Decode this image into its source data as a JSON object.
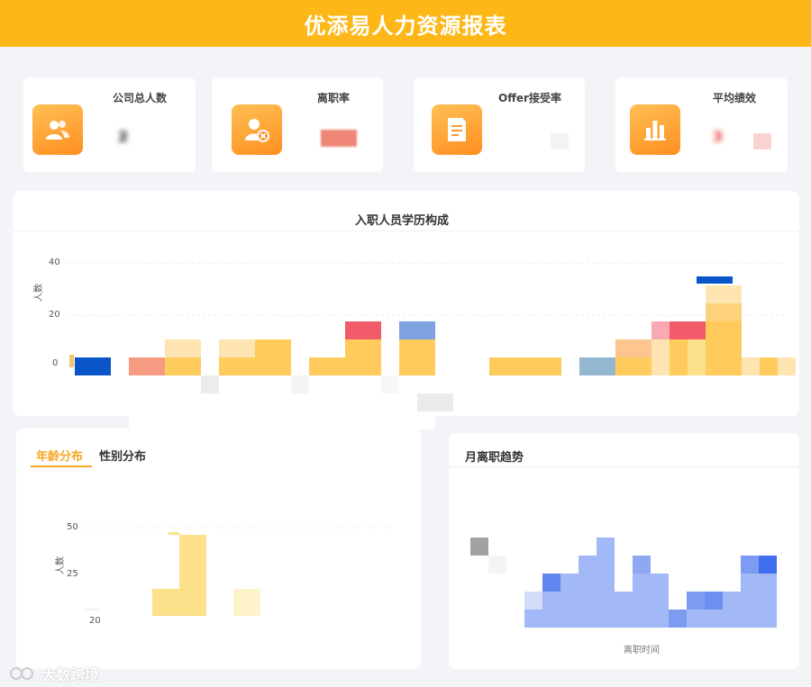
{
  "header": {
    "title": "优添易人力资源报表"
  },
  "kpis": [
    {
      "label": "公司总人数",
      "icon": "users-icon",
      "value": "2"
    },
    {
      "label": "离职率",
      "icon": "user-remove-icon",
      "value": ""
    },
    {
      "label": "Offer接受率",
      "icon": "document-icon",
      "value": ""
    },
    {
      "label": "平均绩效",
      "icon": "bar-chart-icon",
      "value": "3"
    }
  ],
  "education_chart": {
    "title": "入职人员学历构成",
    "ylabel": "人数",
    "yticks": [
      "40",
      "20",
      "0"
    ]
  },
  "age_panel": {
    "tabs": [
      {
        "label": "年龄分布",
        "active": true
      },
      {
        "label": "性别分布",
        "active": false
      }
    ],
    "ylabel": "人数",
    "yticks": [
      "50",
      "25"
    ],
    "xtick": "20"
  },
  "turnover_panel": {
    "title": "月离职趋势",
    "xlabel": "离职时间"
  },
  "watermark": {
    "text": "大数跨境"
  },
  "colors": {
    "brand": "#fdb717",
    "bar_yellow": "#fecb5c",
    "bar_light": "#fde4b0",
    "bar_red": "#f25b6a",
    "bar_blue": "#0a55c8",
    "bar_periwinkle": "#a3b8f7"
  }
}
